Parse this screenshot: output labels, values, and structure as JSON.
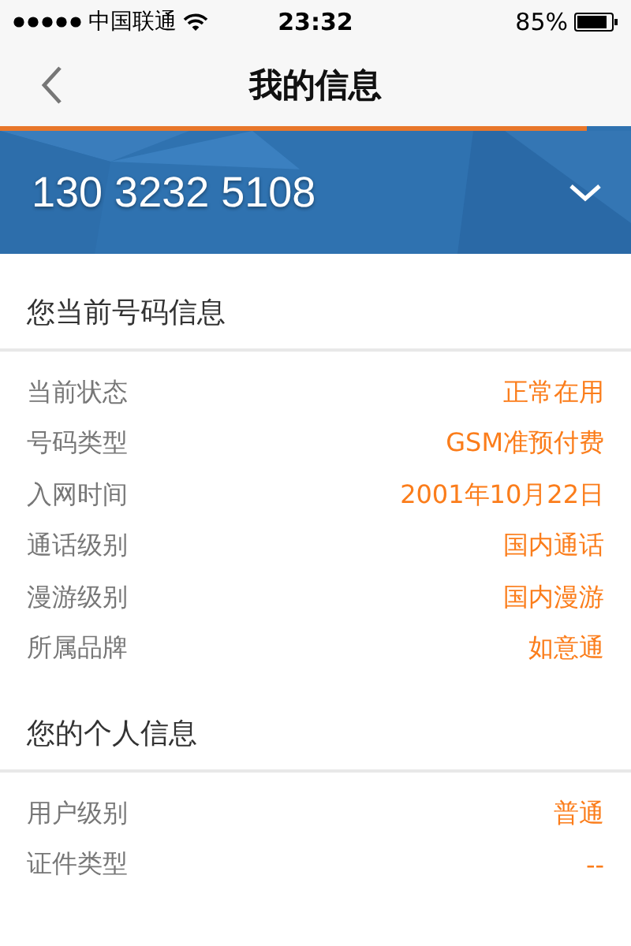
{
  "status_bar": {
    "carrier": "中国联通",
    "time": "23:32",
    "battery": "85%"
  },
  "nav": {
    "title": "我的信息"
  },
  "banner": {
    "number": "130 3232 5108"
  },
  "sections": [
    {
      "title": "您当前号码信息",
      "rows": [
        {
          "label": "当前状态",
          "value": "正常在用"
        },
        {
          "label": "号码类型",
          "value": "GSM准预付费"
        },
        {
          "label": "入网时间",
          "value": "2001年10月22日"
        },
        {
          "label": "通话级别",
          "value": "国内通话"
        },
        {
          "label": "漫游级别",
          "value": "国内漫游"
        },
        {
          "label": "所属品牌",
          "value": "如意通"
        }
      ]
    },
    {
      "title": "您的个人信息",
      "rows": [
        {
          "label": "用户级别",
          "value": "普通"
        },
        {
          "label": "证件类型",
          "value": "--"
        }
      ]
    }
  ]
}
